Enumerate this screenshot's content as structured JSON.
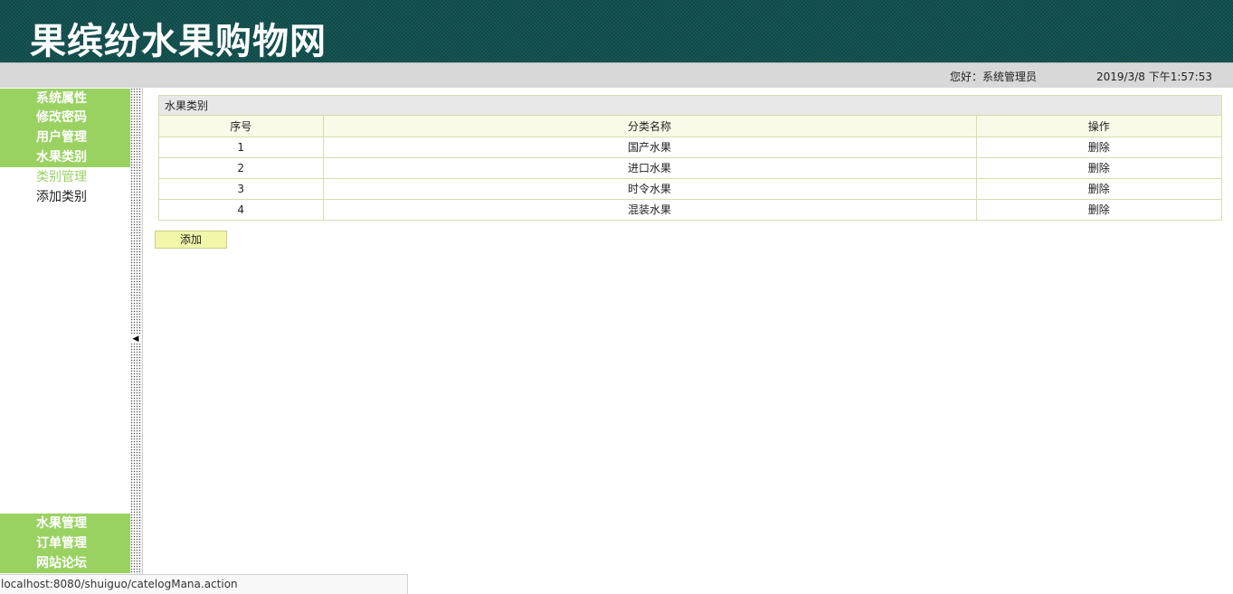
{
  "header": {
    "title": "果缤纷水果购物网"
  },
  "infobar": {
    "greeting": "您好：系统管理员",
    "datetime": "2019/3/8 下午1:57:53"
  },
  "sidebar": {
    "top_menu": [
      "系统属性",
      "修改密码",
      "用户管理",
      "水果类别"
    ],
    "sub_links": {
      "active": "类别管理",
      "add": "添加类别"
    },
    "bottom_menu": [
      "水果管理",
      "订单管理",
      "网站论坛"
    ]
  },
  "panel": {
    "title": "水果类别",
    "columns": [
      "序号",
      "分类名称",
      "操作"
    ],
    "rows": [
      {
        "no": "1",
        "name": "国产水果",
        "action": "删除"
      },
      {
        "no": "2",
        "name": "进口水果",
        "action": "删除"
      },
      {
        "no": "3",
        "name": "时令水果",
        "action": "删除"
      },
      {
        "no": "4",
        "name": "混装水果",
        "action": "删除"
      }
    ]
  },
  "add_button": "添加",
  "statusbar": "localhost:8080/shuiguo/catelogMana.action",
  "colors": {
    "header_bg": "#0d4a48",
    "menu_green": "#9ad262",
    "button_bg": "#f1f6a9"
  },
  "icons": {
    "collapse": "caret-left-icon"
  }
}
